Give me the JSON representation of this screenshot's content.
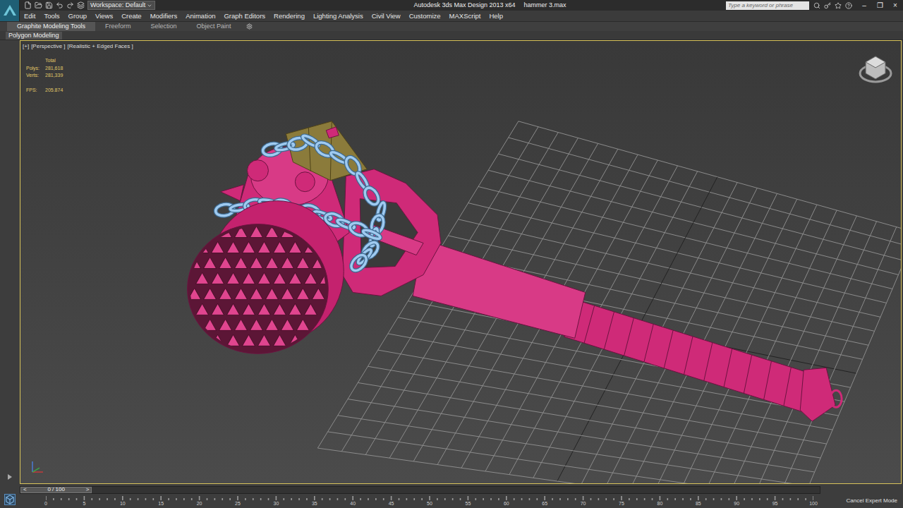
{
  "window": {
    "title": "Autodesk 3ds Max Design 2013 x64",
    "file": "hammer 3.max",
    "controls": [
      "–",
      "❐",
      "×"
    ]
  },
  "workspace": {
    "label": "Workspace: Default"
  },
  "search": {
    "placeholder": "Type a keyword or phrase"
  },
  "menu": [
    "Edit",
    "Tools",
    "Group",
    "Views",
    "Create",
    "Modifiers",
    "Animation",
    "Graph Editors",
    "Rendering",
    "Lighting Analysis",
    "Civil View",
    "Customize",
    "MAXScript",
    "Help"
  ],
  "ribbon": {
    "tabs": [
      {
        "label": "Graphite Modeling Tools",
        "selected": true
      },
      {
        "label": "Freeform",
        "selected": false
      },
      {
        "label": "Selection",
        "selected": false
      },
      {
        "label": "Object Paint",
        "selected": false
      }
    ],
    "panel": "Polygon Modeling"
  },
  "viewport": {
    "labels": [
      "[+]",
      "[Perspective ]",
      "[Realistic + Edged Faces ]"
    ],
    "active": true,
    "stats": {
      "header": "Total",
      "rows": [
        {
          "label": "Polys:",
          "value": "281,618"
        },
        {
          "label": "Verts:",
          "value": "281,339"
        }
      ],
      "fps_label": "FPS:",
      "fps": "205.874"
    }
  },
  "time_slider": {
    "label": "0 / 100",
    "prev": "<",
    "next": ">",
    "level": 0
  },
  "track_bar": {
    "ticks": [
      "0",
      "5",
      "10",
      "15",
      "20",
      "25",
      "30",
      "35",
      "40",
      "45",
      "50",
      "55",
      "60",
      "65",
      "70",
      "75",
      "80",
      "85",
      "90",
      "95",
      "100"
    ]
  },
  "status": {
    "expert_mode_button": "Cancel Expert Mode"
  }
}
